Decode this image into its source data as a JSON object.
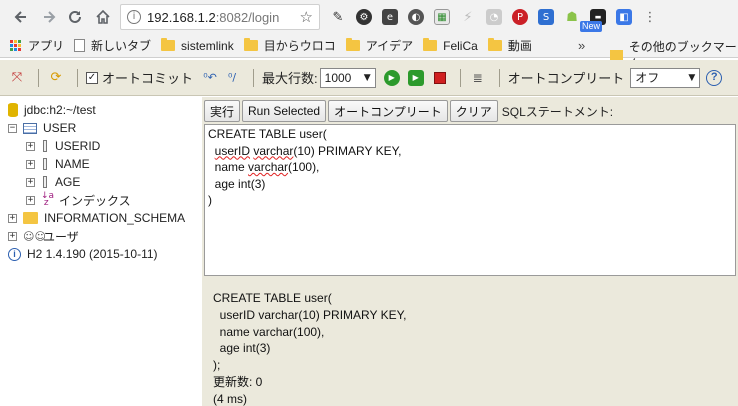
{
  "browser": {
    "url_host": "192.168.1.2",
    "url_path": ":8082/login",
    "new_badge": "New"
  },
  "bookmarks": {
    "apps_label": "アプリ",
    "items": [
      "新しいタブ",
      "sistemlink",
      "目からウロコ",
      "アイデア",
      "FeliCa",
      "動画"
    ],
    "more": "»",
    "other": "その他のブックマーク"
  },
  "toolbar": {
    "autocommit_label": "オートコミット",
    "max_rows_label": "最大行数:",
    "max_rows_value": "1000",
    "autocomplete_label": "オートコンプリート",
    "autocomplete_value": "オフ",
    "help": "?"
  },
  "tree": {
    "connection": "jdbc:h2:~/test",
    "table": "USER",
    "columns": [
      "USERID",
      "NAME",
      "AGE"
    ],
    "indexes": "インデックス",
    "schema": "INFORMATION_SCHEMA",
    "users": "ユーザ",
    "version": "H2 1.4.190 (2015-10-11)"
  },
  "editor": {
    "run_button": "実行",
    "run_selected_button": "Run Selected",
    "autocomplete_button": "オートコンプリート",
    "clear_button": "クリア",
    "sql_label": "SQLステートメント:",
    "lines": {
      "l1": "CREATE TABLE user(",
      "l2a": "  ",
      "l2b": "userID",
      "l2c": " ",
      "l2d": "varchar",
      "l2e": "(10) PRIMARY KEY,",
      "l3a": "  name ",
      "l3b": "varchar",
      "l3c": "(100),",
      "l4": "  age int(3)",
      "l5": ")"
    }
  },
  "result": {
    "text": "CREATE TABLE user(\n  userID varchar(10) PRIMARY KEY,\n  name varchar(100),\n  age int(3)\n);\n更新数: 0\n(4 ms)"
  },
  "colors": {
    "toolbar_bg": "#ebe9dc",
    "run_green": "#2c9a2c",
    "stop_red": "#d02020",
    "help_blue": "#2b5fb0"
  }
}
